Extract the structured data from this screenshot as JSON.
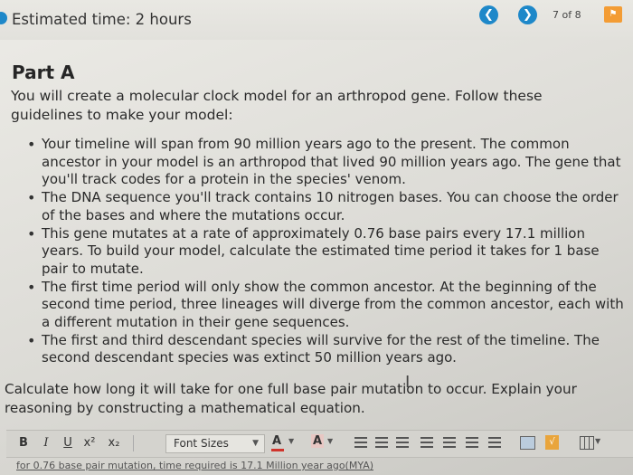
{
  "header": {
    "estimated_time": "Estimated time: 2 hours",
    "page_counter": "7 of 8",
    "prev_icon": "chevron-left-icon",
    "next_icon": "chevron-right-icon",
    "flag_icon": "flag-icon",
    "accent_color": "#1e88c9",
    "flag_color": "#f39c34"
  },
  "content": {
    "part_title": "Part A",
    "intro": "You will create a molecular clock model for an arthropod gene. Follow these guidelines to make your model:",
    "bullets": [
      "Your timeline will span from 90 million years ago to the present. The common ancestor in your model is an arthropod that lived 90 million years ago. The gene that you'll track codes for a protein in the species' venom.",
      "The DNA sequence you'll track contains 10 nitrogen bases. You can choose the order of the bases and where the mutations occur.",
      "This gene mutates at a rate of approximately 0.76 base pairs every 17.1 million years. To build your model, calculate the estimated time period it takes for 1 base pair to mutate.",
      "The first time period will only show the common ancestor. At the beginning of the second time period, three lineages will diverge from the common ancestor, each with a different mutation in their gene sequences.",
      "The first and third descendant species will survive for the rest of the timeline. The second descendant species was extinct 50 million years ago."
    ],
    "question": "Calculate how long it will take for one full base pair mutation to occur. Explain your reasoning by constructing a mathematical equation."
  },
  "toolbar": {
    "bold": "B",
    "italic": "I",
    "underline": "U",
    "superscript": "x²",
    "subscript": "x₂",
    "font_sizes": "Font Sizes",
    "font_color_label": "A",
    "highlight_label": "A",
    "font_color": "#d0342c",
    "highlight_color": "#e8c7c3"
  },
  "answer": {
    "value": "for 0.76 base pair mutation, time required is 17.1 Million year ago(MYA)"
  }
}
